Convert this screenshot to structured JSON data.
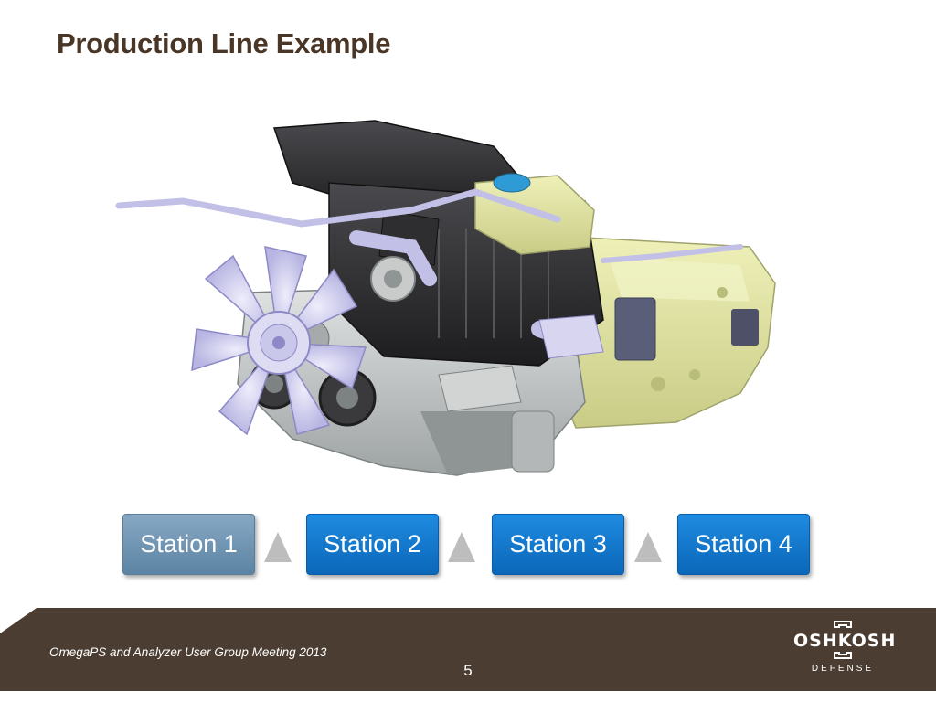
{
  "slide": {
    "title": "Production Line Example",
    "page_number": "5"
  },
  "stations": [
    {
      "label": "Station 1",
      "state": "active"
    },
    {
      "label": "Station 2",
      "state": "normal"
    },
    {
      "label": "Station 3",
      "state": "normal"
    },
    {
      "label": "Station 4",
      "state": "normal"
    }
  ],
  "footer": {
    "text": "OmegaPS and Analyzer User Group Meeting 2013",
    "logo_name": "OSHKOSH",
    "logo_sub": "DEFENSE"
  },
  "image": {
    "subject": "engine-and-transmission-render"
  },
  "colors": {
    "title": "#4a3626",
    "station_active": "#6f93b1",
    "station_normal": "#1278cc",
    "arrow": "#bdbdbd",
    "footer_bg": "#4b3d31",
    "transmission": "#e4e6a6",
    "engine_body": "#2b2b2d",
    "fan": "#c9c7ea"
  }
}
